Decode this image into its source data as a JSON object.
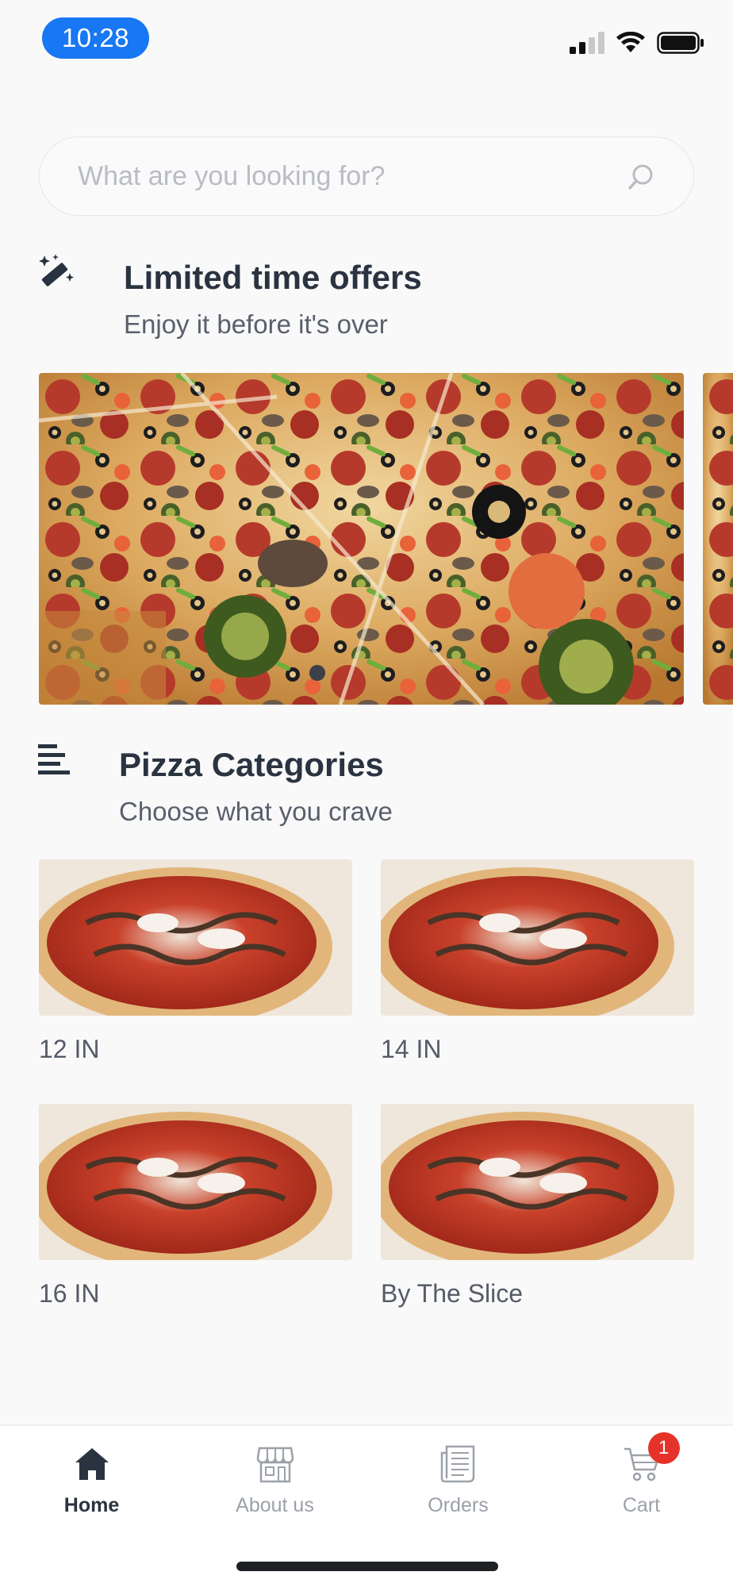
{
  "status_bar": {
    "time": "10:28",
    "icons": [
      "cellular-signal-icon",
      "wifi-icon",
      "battery-icon"
    ]
  },
  "search": {
    "placeholder": "What are you looking for?",
    "icon": "search-icon"
  },
  "offers": {
    "icon": "magic-wand-icon",
    "title": "Limited time offers",
    "subtitle": "Enjoy it before it's over",
    "slide_count": 1,
    "active_slide": 1
  },
  "categories": {
    "icon": "list-icon",
    "title": "Pizza Categories",
    "subtitle": "Choose what you crave",
    "items": [
      {
        "label": "12 IN"
      },
      {
        "label": "14 IN"
      },
      {
        "label": "16 IN"
      },
      {
        "label": "By The Slice"
      }
    ]
  },
  "bottom_nav": {
    "items": [
      {
        "label": "Home",
        "icon": "home-icon",
        "active": true
      },
      {
        "label": "About us",
        "icon": "store-icon",
        "active": false
      },
      {
        "label": "Orders",
        "icon": "orders-icon",
        "active": false
      },
      {
        "label": "Cart",
        "icon": "cart-icon",
        "active": false,
        "badge": "1"
      }
    ]
  },
  "colors": {
    "accent": "#1877f2",
    "text": "#2a3340",
    "muted": "#9ca1a9",
    "badge": "#e5332a",
    "background": "#f9f9fa"
  }
}
